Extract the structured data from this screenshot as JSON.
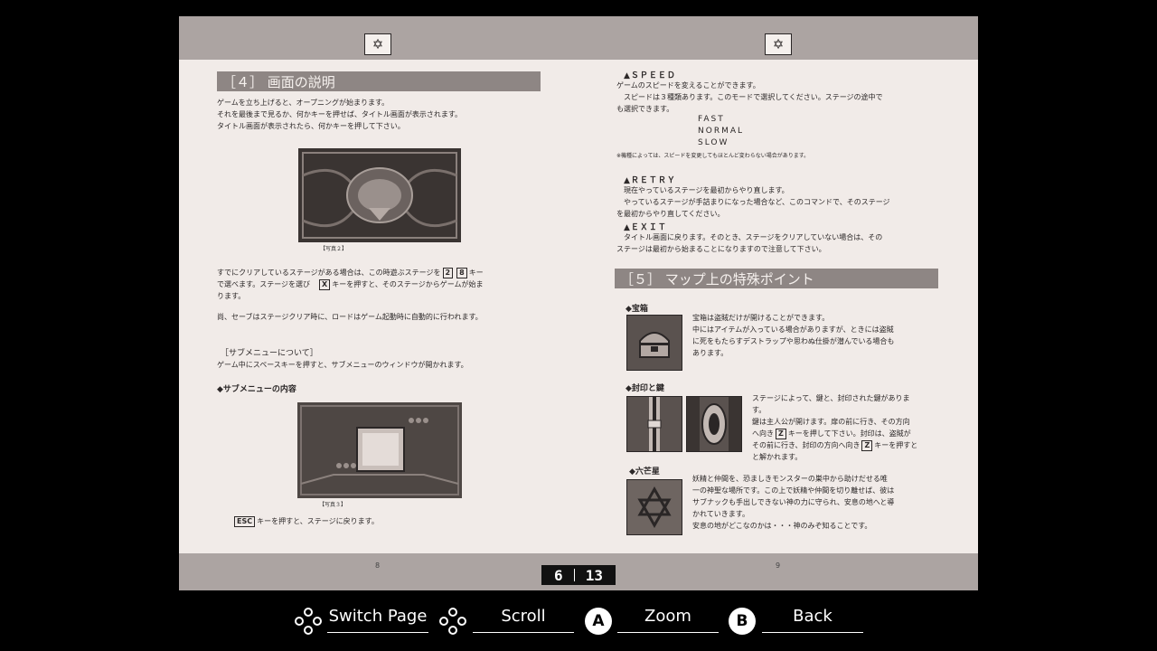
{
  "manual": {
    "left_page": {
      "page_number": "8",
      "section_title": "［４］ 画面の説明",
      "intro_lines": [
        "ゲームを立ち上げると、オープニングが始まります。",
        "それを最後まで見るか、何かキーを押せば、タイトル画面が表示されます。",
        "タイトル画面が表示されたら、何かキーを押して下さい。"
      ],
      "photo2_caption": "【写真２】",
      "stage_line1_a": "すでにクリアしているステージがある場合は、この時遊ぶステージを",
      "stage_key_2": "2",
      "stage_key_8": "8",
      "stage_line1_b": "キー",
      "stage_line2_a": "で選べます。ステージを選び",
      "stage_key_x": "X",
      "stage_line2_b": "キーを押すと、そのステージからゲームが始ま",
      "stage_line3": "ります。",
      "save_note": "尚、セーブはステージクリア時に、ロードはゲーム起動時に自動的に行われます。",
      "submenu_heading": "［サブメニューについて］",
      "submenu_text": "ゲーム中にスペースキーを押すと、サブメニューのウィンドウが開かれます。",
      "submenu_contents_heading": "◆サブメニューの内容",
      "photo3_caption": "【写真３】",
      "esc_key": "ESC",
      "esc_text": "キーを押すと、ステージに戻ります。"
    },
    "right_page": {
      "page_number": "9",
      "speed_heading": "▲ＳＰＥＥＤ",
      "speed_lines": [
        "ゲームのスピードを変えることができます。",
        "　スピードは３種類あります。このモードで選択してください。ステージの途中で",
        "も選択できます。"
      ],
      "speed_options": [
        "FAST",
        "NORMAL",
        "SLOW"
      ],
      "speed_note": "※機種によっては、スピードを変更してもほとんど変わらない場合があります。",
      "retry_heading": "▲ＲＥＴＲＹ",
      "retry_lines": [
        "　現在やっているステージを最初からやり直します。",
        "　やっているステージが手詰まりになった場合など、このコマンドで、そのステージ",
        "を最初からやり直してください。"
      ],
      "exit_heading": "▲ＥＸＩＴ",
      "exit_lines": [
        "　タイトル画面に戻ります。そのとき、ステージをクリアしていない場合は、その",
        "ステージは最初から始まることになりますので注意して下さい。"
      ],
      "section5_title": "［５］ マップ上の特殊ポイント",
      "treasure_heading": "◆宝箱",
      "treasure_lines": [
        "宝箱は盗賊だけが開けることができます。",
        "中にはアイテムが入っている場合がありますが、ときには盗賊",
        "に死をもたらすデストラップや思わぬ仕掛が潜んでいる場合も",
        "あります。"
      ],
      "seal_heading": "◆封印と鍵",
      "seal_lines": [
        "ステージによって、鍵と、封印された鍵がありま",
        "す。",
        "鍵は主人公が開けます。扉の前に行き、その方向"
      ],
      "seal_line4_a": "へ向き",
      "seal_key_z": "Z",
      "seal_line4_b": "キーを押して下さい。封印は、盗賊が",
      "seal_line5_a": "その前に行き、封印の方向へ向き",
      "seal_key_z2": "Z",
      "seal_line5_b": "キーを押すと",
      "seal_line6": "と解かれます。",
      "hexagram_heading": "◆六芒星",
      "hexagram_lines": [
        "妖精と仲間を、恐ましきモンスターの巣中から助けだせる唯",
        "一の神聖な場所です。この上で妖精や仲間を切り離せば、彼は",
        "サブナックも手出しできない神の力に守られ、安息の地へと導",
        "かれていきます。",
        "安息の地がどこなのかは・・・神のみぞ知ることです。"
      ]
    },
    "page_counter": {
      "current": "6",
      "total": "13"
    }
  },
  "controls": {
    "switch_page": "Switch Page",
    "scroll": "Scroll",
    "zoom_button": "A",
    "zoom": "Zoom",
    "back_button": "B",
    "back": "Back"
  }
}
